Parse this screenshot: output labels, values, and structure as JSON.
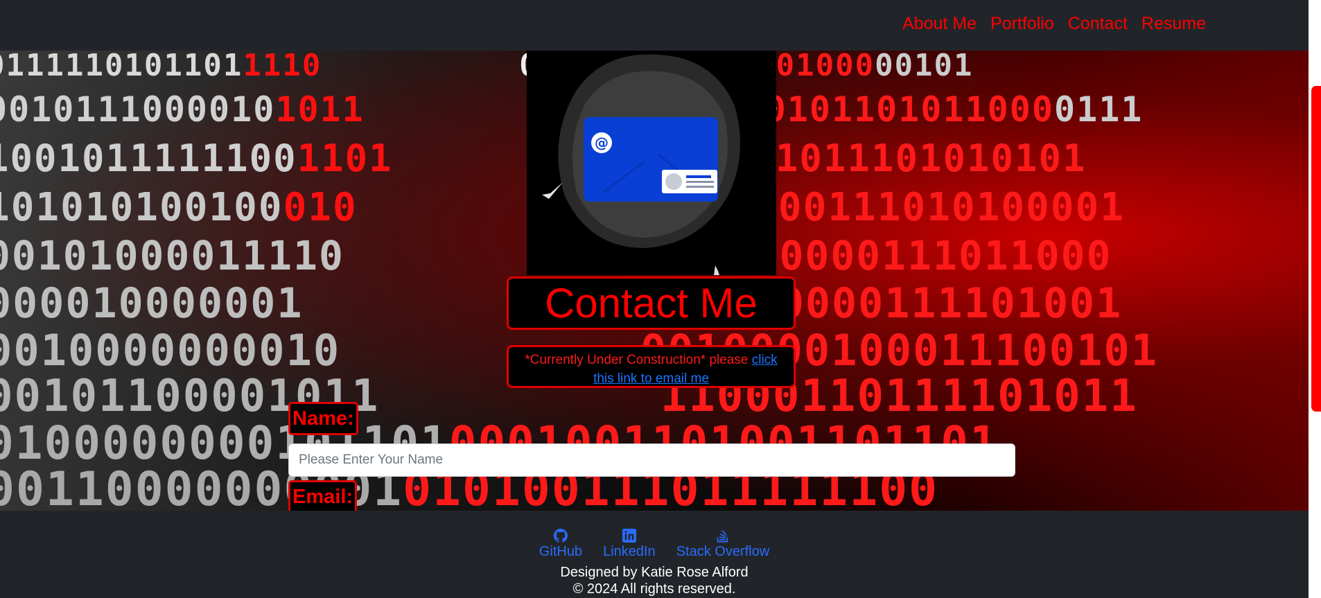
{
  "nav": {
    "links": [
      {
        "label": "About Me"
      },
      {
        "label": "Portfolio"
      },
      {
        "label": "Contact"
      },
      {
        "label": "Resume"
      }
    ]
  },
  "hero": {
    "title": "Contact Me",
    "notice_text": "*Currently Under Construction* please ",
    "notice_link": "click this link to email me",
    "illustration_icon": "email-card-icon"
  },
  "form": {
    "name_label": "Name:",
    "name_placeholder": "Please Enter Your Name",
    "email_label": "Email:"
  },
  "footer": {
    "links": [
      {
        "label": "GitHub",
        "icon": "github-icon"
      },
      {
        "label": "LinkedIn",
        "icon": "linkedin-icon"
      },
      {
        "label": "Stack Overflow",
        "icon": "stackoverflow-icon"
      }
    ],
    "designed_by": "Designed by Katie Rose Alford",
    "copyright": "© 2024 All rights reserved."
  },
  "colors": {
    "accent": "#ff0000",
    "navbar_bg": "#212529",
    "link": "#2a6bff"
  }
}
